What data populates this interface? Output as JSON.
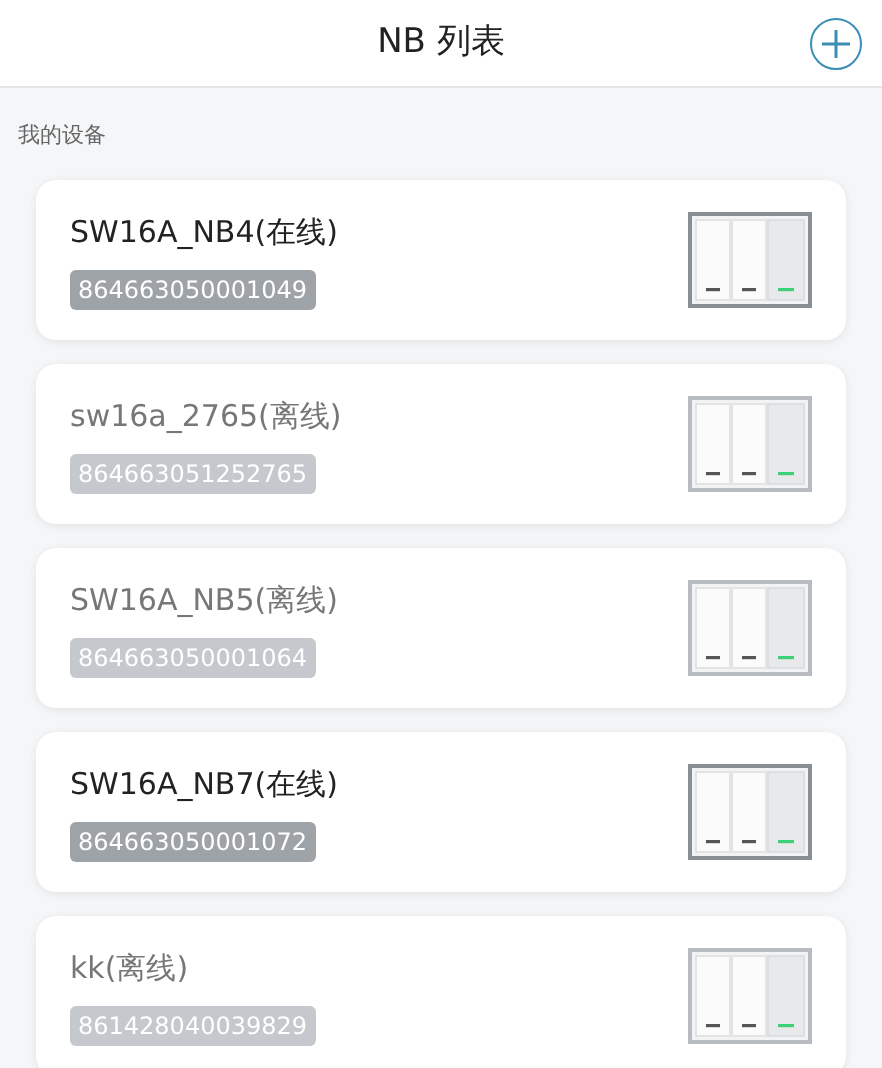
{
  "header": {
    "title": "NB 列表"
  },
  "section": {
    "title": "我的设备"
  },
  "devices": [
    {
      "name": "SW16A_NB4(在线)",
      "id": "864663050001049",
      "online": true
    },
    {
      "name": "sw16a_2765(离线)",
      "id": "864663051252765",
      "online": false
    },
    {
      "name": "SW16A_NB5(离线)",
      "id": "864663050001064",
      "online": false
    },
    {
      "name": "SW16A_NB7(在线)",
      "id": "864663050001072",
      "online": true
    },
    {
      "name": "kk(离线)",
      "id": "861428040039829",
      "online": false
    }
  ]
}
